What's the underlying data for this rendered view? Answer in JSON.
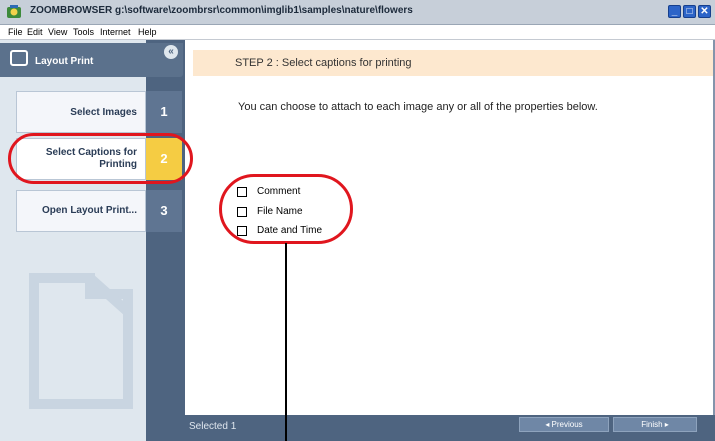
{
  "window": {
    "title": "ZOOMBROWSER g:\\software\\zoombrsr\\common\\imglib1\\samples\\nature\\flowers",
    "controls": {
      "minimize": "_",
      "maximize": "□",
      "close": "✕"
    }
  },
  "menu": [
    "File",
    "Edit",
    "View",
    "Tools",
    "Internet",
    "Help"
  ],
  "sidebar": {
    "title": "Layout Print",
    "collapse_glyph": "«",
    "steps": [
      {
        "label": "Select Images",
        "number": "1",
        "active": false
      },
      {
        "label": "Select Captions for Printing",
        "number": "2",
        "active": true
      },
      {
        "label": "Open Layout Print...",
        "number": "3",
        "active": false
      }
    ]
  },
  "main": {
    "step_title": "STEP 2 : Select captions for printing",
    "instruction": "You can choose to attach to each image any or all of the properties below.",
    "options": [
      {
        "label": "Comment",
        "checked": false
      },
      {
        "label": "File Name",
        "checked": false
      },
      {
        "label": "Date and Time",
        "checked": false
      }
    ]
  },
  "footer": {
    "selected_text": "Selected   1",
    "previous": "◂   Previous",
    "finish": "Finish   ▸"
  },
  "colors": {
    "accent_active": "#f5cc43",
    "annotation": "#e0161e",
    "sidebar_dark": "#4e6480"
  }
}
